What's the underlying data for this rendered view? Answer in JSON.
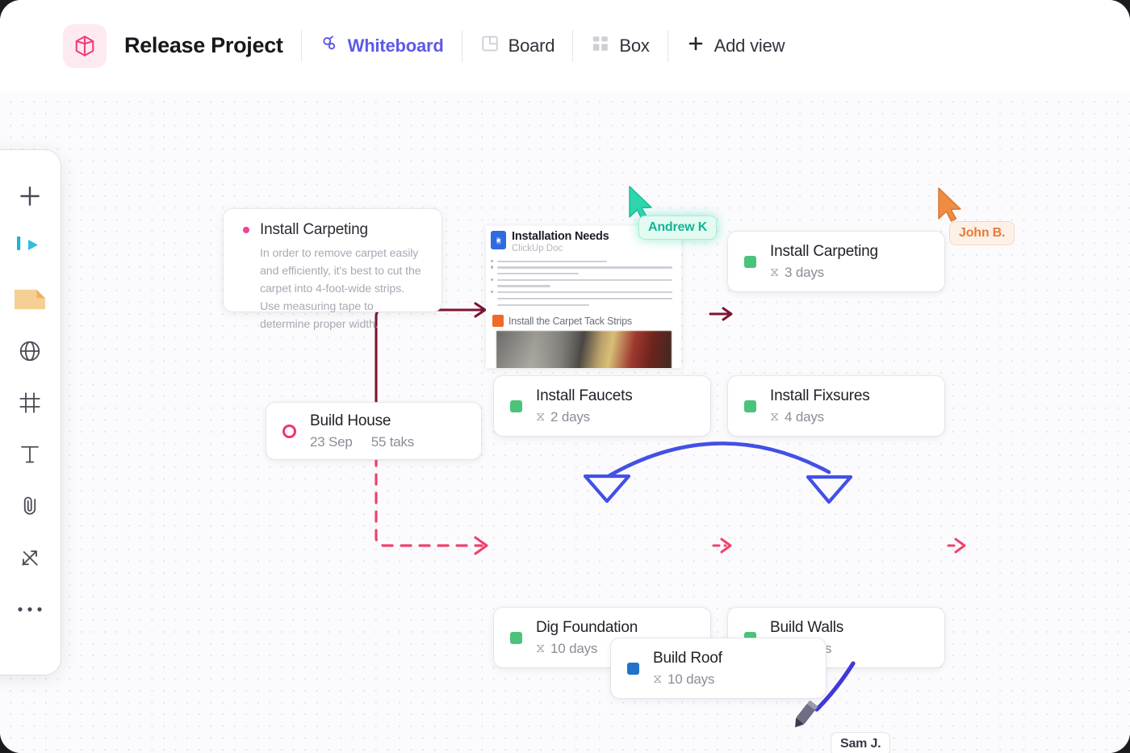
{
  "header": {
    "project_title": "Release Project",
    "logo_icon": "cube-icon",
    "views": [
      {
        "label": "Whiteboard",
        "icon": "whiteboard-icon",
        "active": true
      },
      {
        "label": "Board",
        "icon": "board-icon",
        "active": false
      },
      {
        "label": "Box",
        "icon": "box-grid-icon",
        "active": false
      },
      {
        "label": "Add view",
        "icon": "plus-icon",
        "active": false
      }
    ]
  },
  "toolbar": {
    "items": [
      {
        "name": "add-tool",
        "icon": "plus-icon"
      },
      {
        "name": "select-tool",
        "icon": "cursor-arrow-icon"
      },
      {
        "name": "sticky-note-tool",
        "icon": "sticky-note-icon"
      },
      {
        "name": "shape-tool",
        "icon": "globe-icon"
      },
      {
        "name": "frame-tool",
        "icon": "frame-icon"
      },
      {
        "name": "text-tool",
        "icon": "text-t-icon"
      },
      {
        "name": "attach-tool",
        "icon": "paperclip-icon"
      },
      {
        "name": "connector-tool",
        "icon": "connector-arrows-icon"
      },
      {
        "name": "more-tool",
        "icon": "ellipsis-icon"
      }
    ]
  },
  "sticky_note": {
    "title": "Install Carpeting",
    "body": "In order to remove carpet easily and efficiently, it's best to cut the carpet into 4-foot-wide strips. Use measuring tape to determine proper width.",
    "dot_color": "#f0419b"
  },
  "doc_embed": {
    "title": "Installation Needs",
    "subtitle": "ClickUp Doc",
    "section_label": "Install the Carpet Tack Strips",
    "doc_icon": "document-icon"
  },
  "cards": [
    {
      "id": "install-carpeting",
      "title": "Install Carpeting",
      "meta": "3 days",
      "meta_icon": "hourglass-icon",
      "status_color": "#4cc37a",
      "status_shape": "square"
    },
    {
      "id": "install-faucets",
      "title": "Install Faucets",
      "meta": "2 days",
      "meta_icon": "hourglass-icon",
      "status_color": "#4cc37a",
      "status_shape": "square"
    },
    {
      "id": "install-fixsures",
      "title": "Install Fixsures",
      "meta": "4 days",
      "meta_icon": "hourglass-icon",
      "status_color": "#4cc37a",
      "status_shape": "square"
    },
    {
      "id": "build-house",
      "title": "Build House",
      "meta": "23 Sep",
      "meta2": "55 taks",
      "status_color": "#f0356b",
      "status_shape": "ring"
    },
    {
      "id": "dig-foundation",
      "title": "Dig Foundation",
      "meta": "10 days",
      "meta_icon": "hourglass-icon",
      "status_color": "#4cc37a",
      "status_shape": "square"
    },
    {
      "id": "build-walls",
      "title": "Build Walls",
      "meta": "20 days",
      "meta_icon": "hourglass-icon",
      "status_color": "#4cc37a",
      "status_shape": "square"
    },
    {
      "id": "build-roof",
      "title": "Build Roof",
      "meta": "10 days",
      "meta_icon": "hourglass-icon",
      "status_color": "#1f74c7",
      "status_shape": "square"
    }
  ],
  "collaborators": [
    {
      "name": "Andrew K",
      "color": "#11b495",
      "style": "teal"
    },
    {
      "name": "John B.",
      "color": "#e87b3a",
      "style": "orange"
    },
    {
      "name": "Sam J.",
      "color": "#3a3a46",
      "style": "grey"
    }
  ],
  "connectors": {
    "solid_maroon": "#7d1430",
    "dashed_pink": "#f0416d",
    "double_blue": "#4350e6",
    "ink_blue": "#4038d8"
  },
  "glyphs": {
    "hourglass": "⧖"
  }
}
